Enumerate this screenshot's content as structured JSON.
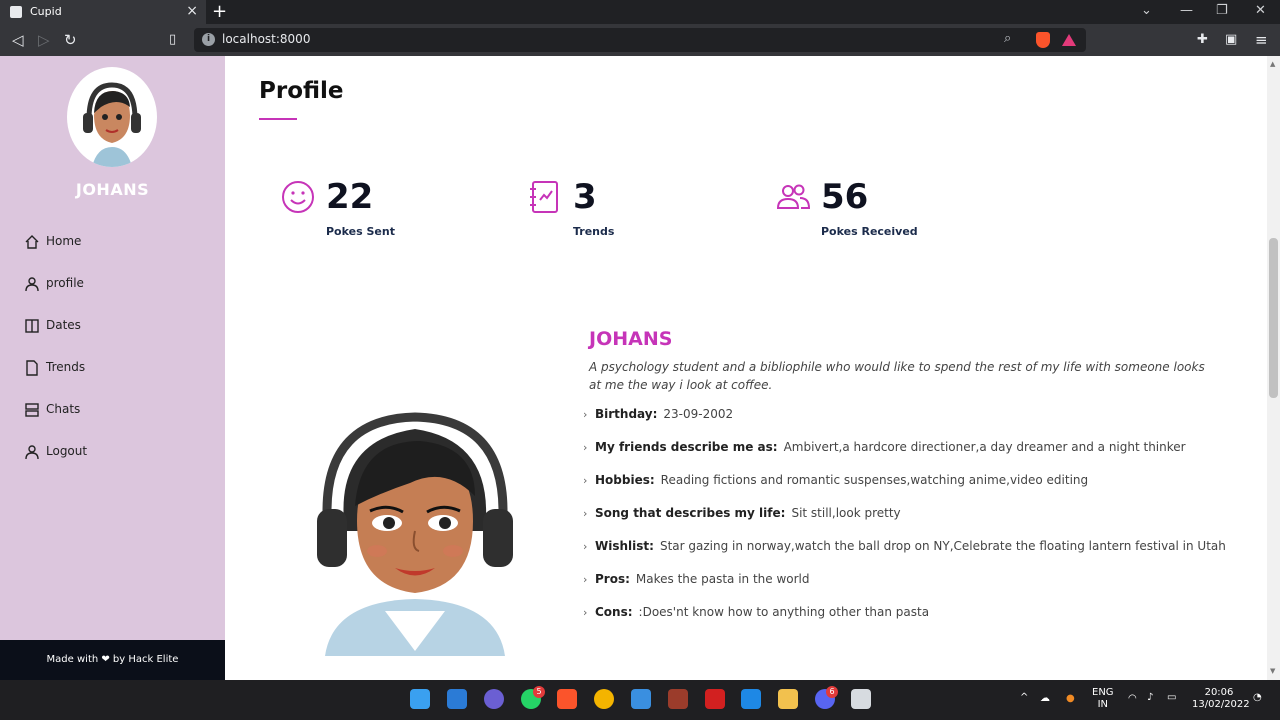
{
  "browser": {
    "tab_title": "Cupid",
    "url": "localhost:8000"
  },
  "sidebar": {
    "name": "JOHANS",
    "items": [
      {
        "label": "Home",
        "icon": "home-icon"
      },
      {
        "label": "profile",
        "icon": "user-icon"
      },
      {
        "label": "Dates",
        "icon": "book-icon"
      },
      {
        "label": "Trends",
        "icon": "file-icon"
      },
      {
        "label": "Chats",
        "icon": "server-icon"
      },
      {
        "label": "Logout",
        "icon": "user-icon"
      }
    ],
    "footer": "Made with ❤ by Hack Elite"
  },
  "main": {
    "title": "Profile",
    "stats": [
      {
        "value": "22",
        "label": "Pokes Sent",
        "icon": "smile-icon"
      },
      {
        "value": "3",
        "label": "Trends",
        "icon": "journal-icon"
      },
      {
        "value": "56",
        "label": "Pokes Received",
        "icon": "people-icon"
      }
    ],
    "profile": {
      "name": "JOHANS",
      "bio": "A psychology student and a bibliophile who would like to spend the rest of my life with someone looks at me the way i look at coffee.",
      "details": [
        {
          "label": "Birthday:",
          "value": "23-09-2002"
        },
        {
          "label": "My friends describe me as:",
          "value": "Ambivert,a hardcore directioner,a day dreamer and a night thinker"
        },
        {
          "label": "Hobbies:",
          "value": "Reading fictions and romantic suspenses,watching anime,video editing"
        },
        {
          "label": "Song that describes my life:",
          "value": "Sit still,look pretty"
        },
        {
          "label": "Wishlist:",
          "value": "Star gazing in norway,watch the ball drop on NY,Celebrate the floating lantern festival in Utah"
        },
        {
          "label": "Pros:",
          "value": "Makes the pasta in the world"
        },
        {
          "label": "Cons:",
          "value": ":Does'nt know how to anything other than pasta"
        }
      ]
    }
  },
  "taskbar": {
    "badges": {
      "whatsapp": "5",
      "discord": "6"
    },
    "lang": "ENG",
    "region": "IN",
    "time": "20:06",
    "date": "13/02/2022"
  },
  "colors": {
    "accent": "#c634b8",
    "sidebar_bg": "#dcc6dd",
    "footer_bg": "#0b0f19"
  }
}
